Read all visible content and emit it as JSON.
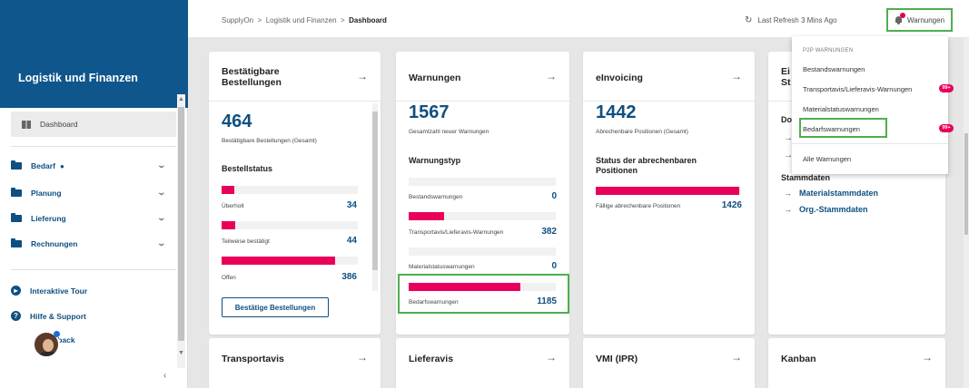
{
  "sidebar": {
    "title": "Logistik und Finanzen",
    "dashboard": "Dashboard",
    "items": [
      {
        "label": "Bedarf",
        "dot": "●"
      },
      {
        "label": "Planung"
      },
      {
        "label": "Lieferung"
      },
      {
        "label": "Rechnungen"
      }
    ],
    "links": [
      {
        "label": "Interaktive Tour",
        "icon": "play-icon"
      },
      {
        "label": "Hilfe & Support",
        "icon": "help-icon"
      },
      {
        "label": "dback",
        "icon": "feedback-icon"
      }
    ],
    "collapse": "‹"
  },
  "header": {
    "crumb1": "SupplyOn",
    "crumb2": "Logistik und Finanzen",
    "crumb3": "Dashboard",
    "sep": ">",
    "refresh": "Last Refresh 3 Mins Ago",
    "warnings": "Warnungen"
  },
  "cards": {
    "bestellungen": {
      "title1": "Bestätigbare",
      "title2": "Bestellungen",
      "count": "464",
      "count_label": "Bestätigbare Bestellungen (Gesamt)",
      "section": "Bestellstatus",
      "bars": [
        {
          "label": "Überholt",
          "value": "34",
          "fraction": 0.09
        },
        {
          "label": "Teilweise bestätigt",
          "value": "44",
          "fraction": 0.1
        },
        {
          "label": "Offen",
          "value": "386",
          "fraction": 0.83
        }
      ],
      "button": "Bestätige Bestellungen"
    },
    "warnungen": {
      "title": "Warnungen",
      "count": "1567",
      "count_label": "Gesamtzahl neuer Warnungen",
      "section": "Warnungstyp",
      "bars": [
        {
          "label": "Bestandswarnungen",
          "value": "0",
          "fraction": 0
        },
        {
          "label": "Transportavis/Lieferavis-Warnungen",
          "value": "382",
          "fraction": 0.24
        },
        {
          "label": "Materialstatuswarnungen",
          "value": "0",
          "fraction": 0
        },
        {
          "label": "Bedarfswarnungen",
          "value": "1185",
          "fraction": 0.76
        }
      ]
    },
    "einvoicing": {
      "title": "eInvoicing",
      "count": "1442",
      "count_label": "Abrechenbare Positionen (Gesamt)",
      "section1": "Status der abrechenbaren",
      "section2": "Positionen",
      "bars": [
        {
          "label": "Fällige abrechenbare Positionen",
          "value": "1426",
          "fraction": 0.99
        }
      ]
    },
    "fourth": {
      "title1": "Ei",
      "title2": "St",
      "section": "Do",
      "stammdaten": "Stammdaten",
      "links": [
        "Materialstammdaten",
        "Org.-Stammdaten"
      ]
    },
    "transportavis": {
      "title": "Transportavis"
    },
    "lieferavis": {
      "title": "Lieferavis"
    },
    "vmi": {
      "title": "VMI (IPR)"
    },
    "kanban": {
      "title": "Kanban"
    }
  },
  "arrow": "→",
  "dropdown": {
    "header": "P2P WARNUNGEN",
    "items": [
      {
        "label": "Bestandswarnungen"
      },
      {
        "label": "Transportavis/Lieferavis-Warnungen",
        "badge": "99+"
      },
      {
        "label": "Materialstatuswarnungen"
      },
      {
        "label": "Bedarfswarnungen",
        "badge": "99+"
      }
    ],
    "all": "Alle Warnungen"
  },
  "colors": {
    "brand": "#0f568c",
    "accent": "#e8005a",
    "highlight": "#4caf50"
  }
}
